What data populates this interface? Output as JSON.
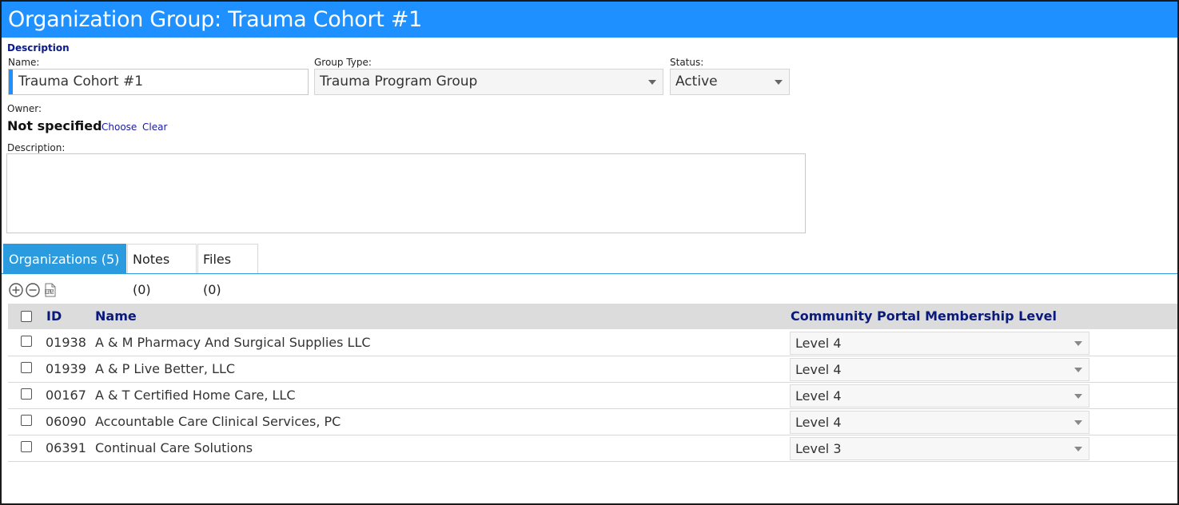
{
  "window": {
    "title": "Organization Group: Trauma Cohort #1"
  },
  "form": {
    "section_label": "Description",
    "name": {
      "label": "Name:",
      "value": "Trauma Cohort #1"
    },
    "group_type": {
      "label": "Group Type:",
      "value": "Trauma Program Group"
    },
    "status": {
      "label": "Status:",
      "value": "Active"
    },
    "owner": {
      "label": "Owner:",
      "value": "Not specified",
      "choose_label": "Choose",
      "clear_label": "Clear"
    },
    "description": {
      "label": "Description:",
      "value": ""
    }
  },
  "tabs": [
    {
      "label": "Organizations (5)",
      "active": true
    },
    {
      "label": "Notes (0)",
      "active": false
    },
    {
      "label": "Files (0)",
      "active": false
    }
  ],
  "toolbar": {
    "icons": [
      "add-circle-icon",
      "remove-circle-icon",
      "excel-export-icon"
    ]
  },
  "grid": {
    "columns": [
      "ID",
      "Name",
      "Community Portal Membership Level"
    ],
    "rows": [
      {
        "id": "01938",
        "name": "A & M Pharmacy And Surgical Supplies LLC",
        "level": "Level 4"
      },
      {
        "id": "01939",
        "name": "A & P Live Better, LLC",
        "level": "Level 4"
      },
      {
        "id": "00167",
        "name": "A & T Certified Home Care, LLC",
        "level": "Level 4"
      },
      {
        "id": "06090",
        "name": "Accountable Care Clinical Services, PC",
        "level": "Level 4"
      },
      {
        "id": "06391",
        "name": "Continual Care Solutions",
        "level": "Level 3"
      }
    ]
  },
  "colors": {
    "title_bar": "#1e90ff",
    "active_tab": "#2b9be0",
    "header_text": "#0a1a7a",
    "link": "#1a1aa0"
  }
}
